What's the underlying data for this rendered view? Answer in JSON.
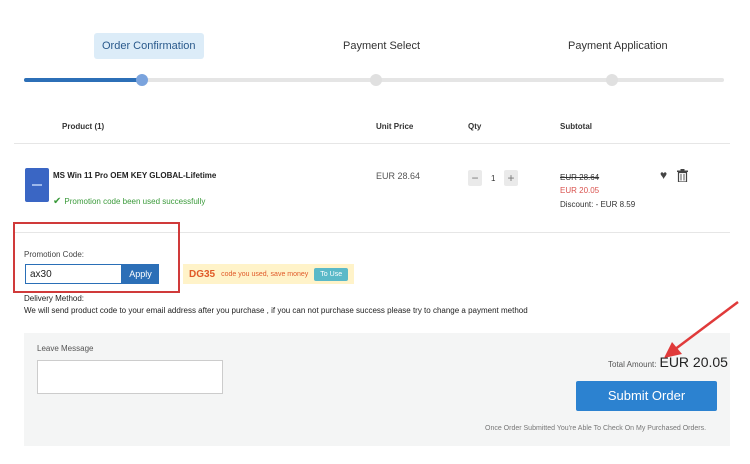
{
  "steps": [
    {
      "label": "Order Confirmation"
    },
    {
      "label": "Payment Select"
    },
    {
      "label": "Payment Application"
    }
  ],
  "table": {
    "headers": {
      "product": "Product (1)",
      "unit_price": "Unit Price",
      "qty": "Qty",
      "subtotal": "Subtotal"
    }
  },
  "item": {
    "title": "MS Win 11 Pro OEM KEY GLOBAL-Lifetime",
    "promo_status": "Promotion code been used successfully",
    "unit_price": "EUR 28.64",
    "qty": "1",
    "qty_minus": "−",
    "qty_plus": "+",
    "subtotal_old": "EUR 28.64",
    "subtotal_new": "EUR 20.05",
    "discount": "Discount: - EUR 8.59"
  },
  "promo": {
    "label": "Promotion Code:",
    "value": "ax30",
    "apply_label": "Apply"
  },
  "coupon": {
    "code": "DG35",
    "text": "code you used, save money",
    "button": "To Use"
  },
  "delivery": {
    "title": "Delivery Method:",
    "text": "We will send product code to your email address after you purchase , if you can not purchase success please try to change a payment method"
  },
  "order": {
    "leave_message_label": "Leave Message",
    "total_label": "Total Amount:",
    "total_value": "EUR 20.05",
    "submit_label": "Submit Order",
    "footnote": "Once Order Submitted You're Able To Check On My Purchased Orders."
  },
  "colors": {
    "accent": "#2c6fb7",
    "highlight_box": "#d03a3a",
    "arrow": "#e03a3a",
    "success": "#3a9a3a",
    "discount_price": "#d9534f"
  },
  "icons": {
    "heart": "heart-icon",
    "trash": "trash-icon",
    "check": "check-icon",
    "arrow": "red-arrow-annotation"
  }
}
